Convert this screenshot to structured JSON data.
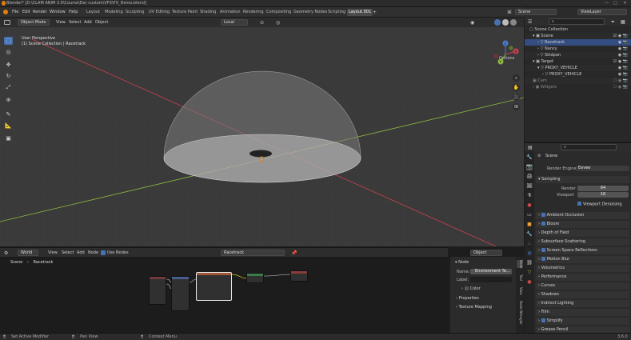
{
  "window": {
    "title": "Blender* [D:\\CLAM ANIM 3.0\\Course\\Der custom\\VFX\\FX_Demo.blend]",
    "controls": [
      "—",
      "□",
      "✕"
    ]
  },
  "menu": [
    "File",
    "Edit",
    "Render",
    "Window",
    "Help"
  ],
  "workspaces": [
    "Layout",
    "Modeling",
    "Sculpting",
    "UV Editing",
    "Texture Paint",
    "Shading",
    "Animation",
    "Rendering",
    "Compositing",
    "Geometry Nodes",
    "Scripting",
    "Layout.001"
  ],
  "active_workspace": "Layout.001",
  "scene": {
    "name": "Scene",
    "view_layer": "ViewLayer"
  },
  "viewport": {
    "mode": "Object Mode",
    "menus": [
      "View",
      "Select",
      "Add",
      "Object"
    ],
    "transform": "Local",
    "info_line1": "User Perspective",
    "info_line2": "(1) Scene Collection | Racetrack",
    "options_label": "Options"
  },
  "gizmo_axes": {
    "x": "X",
    "y": "Y",
    "z": "Z"
  },
  "node_editor": {
    "type": "World",
    "menus": [
      "View",
      "Select",
      "Add",
      "Node"
    ],
    "use_nodes_label": "Use Nodes",
    "world_name": "Racetrack",
    "slot": "Object",
    "breadcrumb": [
      "Scene",
      "Racetrack"
    ]
  },
  "node_sidebar": {
    "section": "Node",
    "name_label": "Name:",
    "name_value": "Environment Te...",
    "label_label": "Label:",
    "color_label": "Color",
    "properties_label": "Properties",
    "texture_mapping_label": "Texture Mapping",
    "tabs": [
      "Node",
      "Tool",
      "View",
      "Node Wrangler"
    ]
  },
  "outliner": {
    "rows": [
      {
        "label": "Scene Collection",
        "indent": 0
      },
      {
        "label": "Scene",
        "indent": 1
      },
      {
        "label": "Racetrack",
        "indent": 2,
        "selected": true
      },
      {
        "label": "Nancy",
        "indent": 2
      },
      {
        "label": "Skidpan",
        "indent": 2
      },
      {
        "label": "Target",
        "indent": 1
      },
      {
        "label": "PROXY_VEHICLE",
        "indent": 2
      },
      {
        "label": "PROXY_VEHICLE",
        "indent": 3
      },
      {
        "label": "Cam",
        "indent": 1
      },
      {
        "label": "Widgets",
        "indent": 1
      }
    ]
  },
  "properties": {
    "scene_label": "Scene",
    "render_engine_label": "Render Engine",
    "render_engine_value": "Eevee",
    "sampling_label": "Sampling",
    "render_label": "Render",
    "render_value": "64",
    "viewport_label": "Viewport",
    "viewport_value": "16",
    "viewport_denoising_label": "Viewport Denoising",
    "panels": [
      {
        "label": "Ambient Occlusion",
        "check": true
      },
      {
        "label": "Bloom",
        "check": true
      },
      {
        "label": "Depth of Field",
        "check": null
      },
      {
        "label": "Subsurface Scattering",
        "check": null
      },
      {
        "label": "Screen Space Reflections",
        "check": true
      },
      {
        "label": "Motion Blur",
        "check": true
      },
      {
        "label": "Volumetrics",
        "check": null
      },
      {
        "label": "Performance",
        "check": null
      },
      {
        "label": "Curves",
        "check": null
      },
      {
        "label": "Shadows",
        "check": null
      },
      {
        "label": "Indirect Lighting",
        "check": null
      },
      {
        "label": "Film",
        "check": null
      },
      {
        "label": "Simplify",
        "check": true
      },
      {
        "label": "Grease Pencil",
        "check": null
      }
    ]
  },
  "status": {
    "left": "Set Active Modifier",
    "middle": "Pan View",
    "right": "Context Menu",
    "version": "3.6.0"
  },
  "colors": {
    "accent": "#4772b3",
    "x_axis": "#c9424f",
    "y_axis": "#8cb83f",
    "z_axis": "#4a7fd6"
  }
}
